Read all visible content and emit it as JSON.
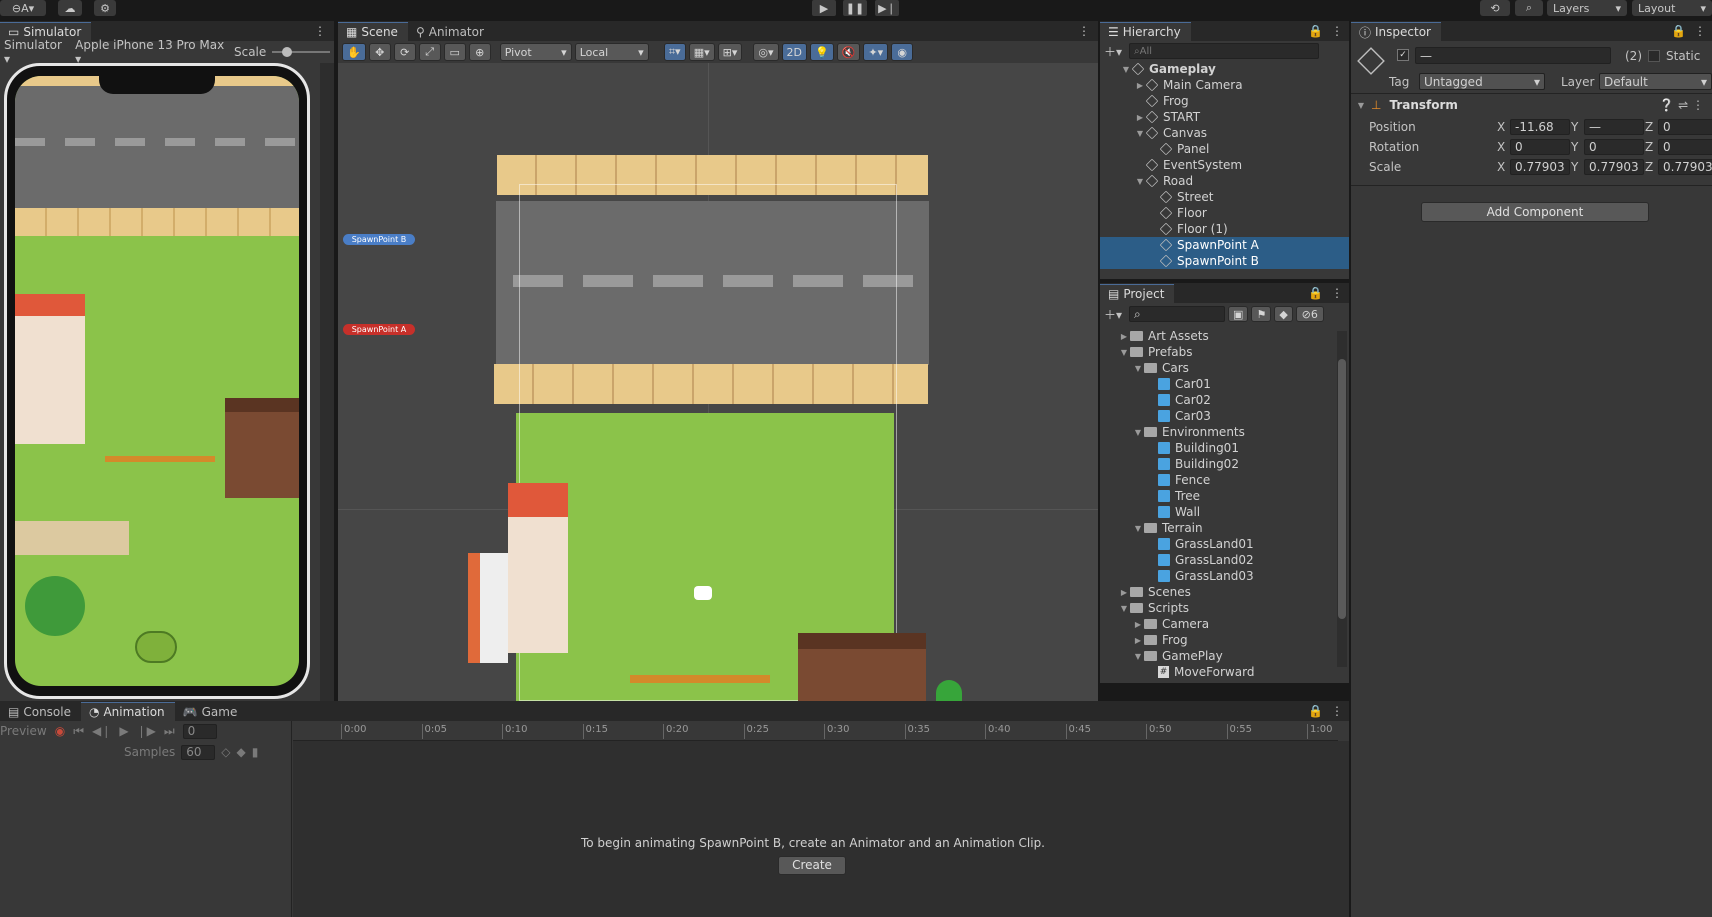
{
  "topbar": {
    "account": "A",
    "play_icon": "play-icon",
    "pause_icon": "pause-icon",
    "step_icon": "step-icon",
    "layers": "Layers",
    "layout": "Layout"
  },
  "simulator": {
    "tab": "Simulator",
    "mode": "Simulator",
    "device": "Apple iPhone 13 Pro Max",
    "scale_label": "Scale"
  },
  "scene": {
    "tab_scene": "Scene",
    "tab_animator": "Animator",
    "pivot": "Pivot",
    "local": "Local",
    "mode_2d": "2D",
    "spawn_b": "SpawnPoint B",
    "spawn_a": "SpawnPoint A"
  },
  "hierarchy": {
    "tab": "Hierarchy",
    "search_placeholder": "All",
    "items": [
      {
        "label": "Gameplay",
        "indent": 0,
        "icon": "scene",
        "arrow": "▼",
        "bold": true
      },
      {
        "label": "Main Camera",
        "indent": 1,
        "icon": "cube",
        "arrow": "▶"
      },
      {
        "label": "Frog",
        "indent": 1,
        "icon": "cube",
        "arrow": ""
      },
      {
        "label": "START",
        "indent": 1,
        "icon": "cube",
        "arrow": "▶"
      },
      {
        "label": "Canvas",
        "indent": 1,
        "icon": "cube",
        "arrow": "▼"
      },
      {
        "label": "Panel",
        "indent": 2,
        "icon": "cube",
        "arrow": ""
      },
      {
        "label": "EventSystem",
        "indent": 1,
        "icon": "cube",
        "arrow": ""
      },
      {
        "label": "Road",
        "indent": 1,
        "icon": "cube",
        "arrow": "▼"
      },
      {
        "label": "Street",
        "indent": 2,
        "icon": "cube",
        "arrow": ""
      },
      {
        "label": "Floor",
        "indent": 2,
        "icon": "cube",
        "arrow": ""
      },
      {
        "label": "Floor (1)",
        "indent": 2,
        "icon": "cube",
        "arrow": ""
      },
      {
        "label": "SpawnPoint A",
        "indent": 2,
        "icon": "cube",
        "arrow": "",
        "selected": true
      },
      {
        "label": "SpawnPoint B",
        "indent": 2,
        "icon": "cube",
        "arrow": "",
        "selected": true
      }
    ]
  },
  "project": {
    "tab": "Project",
    "hidden_count": "6",
    "items": [
      {
        "label": "Art Assets",
        "indent": 1,
        "icon": "folder",
        "arrow": "▶"
      },
      {
        "label": "Prefabs",
        "indent": 1,
        "icon": "folder",
        "arrow": "▼"
      },
      {
        "label": "Cars",
        "indent": 2,
        "icon": "folder",
        "arrow": "▼"
      },
      {
        "label": "Car01",
        "indent": 3,
        "icon": "prefab",
        "arrow": ""
      },
      {
        "label": "Car02",
        "indent": 3,
        "icon": "prefab",
        "arrow": ""
      },
      {
        "label": "Car03",
        "indent": 3,
        "icon": "prefab",
        "arrow": ""
      },
      {
        "label": "Environments",
        "indent": 2,
        "icon": "folder",
        "arrow": "▼"
      },
      {
        "label": "Building01",
        "indent": 3,
        "icon": "prefab",
        "arrow": ""
      },
      {
        "label": "Building02",
        "indent": 3,
        "icon": "prefab",
        "arrow": ""
      },
      {
        "label": "Fence",
        "indent": 3,
        "icon": "prefab",
        "arrow": ""
      },
      {
        "label": "Tree",
        "indent": 3,
        "icon": "prefab",
        "arrow": ""
      },
      {
        "label": "Wall",
        "indent": 3,
        "icon": "prefab",
        "arrow": ""
      },
      {
        "label": "Terrain",
        "indent": 2,
        "icon": "folder",
        "arrow": "▼"
      },
      {
        "label": "GrassLand01",
        "indent": 3,
        "icon": "prefab",
        "arrow": ""
      },
      {
        "label": "GrassLand02",
        "indent": 3,
        "icon": "prefab",
        "arrow": ""
      },
      {
        "label": "GrassLand03",
        "indent": 3,
        "icon": "prefab",
        "arrow": ""
      },
      {
        "label": "Scenes",
        "indent": 1,
        "icon": "folder",
        "arrow": "▶"
      },
      {
        "label": "Scripts",
        "indent": 1,
        "icon": "folder",
        "arrow": "▼"
      },
      {
        "label": "Camera",
        "indent": 2,
        "icon": "folder",
        "arrow": "▶"
      },
      {
        "label": "Frog",
        "indent": 2,
        "icon": "folder",
        "arrow": "▶"
      },
      {
        "label": "GamePlay",
        "indent": 2,
        "icon": "folder",
        "arrow": "▼"
      },
      {
        "label": "MoveForward",
        "indent": 3,
        "icon": "script",
        "arrow": ""
      }
    ]
  },
  "inspector": {
    "tab": "Inspector",
    "name_value": "—",
    "count": "(2)",
    "static": "Static",
    "tag_label": "Tag",
    "tag_value": "Untagged",
    "layer_label": "Layer",
    "layer_value": "Default",
    "component": "Transform",
    "position_label": "Position",
    "rotation_label": "Rotation",
    "scale_label": "Scale",
    "pos": {
      "x": "-11.68",
      "y": "—",
      "z": "0"
    },
    "rot": {
      "x": "0",
      "y": "0",
      "z": "0"
    },
    "scl": {
      "x": "0.77903",
      "y": "0.77903",
      "z": "0.77903"
    },
    "add_component": "Add Component"
  },
  "bottom": {
    "tab_console": "Console",
    "tab_animation": "Animation",
    "tab_game": "Game",
    "preview": "Preview",
    "frame": "0",
    "samples_label": "Samples",
    "samples_value": "60",
    "ticks": [
      "0:00",
      "0:05",
      "0:10",
      "0:15",
      "0:20",
      "0:25",
      "0:30",
      "0:35",
      "0:40",
      "0:45",
      "0:50",
      "0:55",
      "1:00"
    ],
    "message": "To begin animating SpawnPoint B, create an Animator and an Animation Clip.",
    "create": "Create"
  }
}
